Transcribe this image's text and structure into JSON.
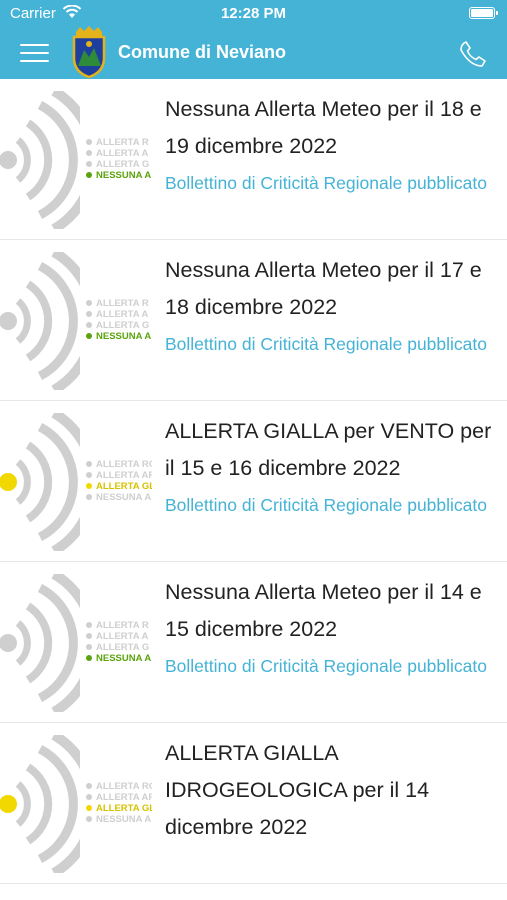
{
  "status_bar": {
    "carrier": "Carrier",
    "time": "12:28 PM"
  },
  "header": {
    "title": "Comune di Neviano"
  },
  "colors": {
    "accent": "#45b3d6",
    "link": "#45b3d6",
    "green_level": "#5aa30c",
    "yellow_level": "#f0d800"
  },
  "icons": {
    "menu": "hamburger-menu-icon",
    "phone": "phone-icon",
    "logo": "coat-of-arms-logo"
  },
  "items": [
    {
      "headline": "Nessuna Allerta Meteo per il 18 e 19 dicembre 2022",
      "subtitle": "Bollettino di Criticità Regionale pubblicato",
      "thumb": {
        "level": "green",
        "legend": [
          "ALLERTA R",
          "ALLERTA A",
          "ALLERTA G",
          "NESSUNA A"
        ]
      }
    },
    {
      "headline": "Nessuna Allerta Meteo per il 17 e 18 dicembre 2022",
      "subtitle": "Bollettino di Criticità Regionale pubblicato",
      "thumb": {
        "level": "green",
        "legend": [
          "ALLERTA R",
          "ALLERTA A",
          "ALLERTA G",
          "NESSUNA A"
        ]
      }
    },
    {
      "headline": "ALLERTA GIALLA per VENTO per il 15 e 16 dicembre 2022",
      "subtitle": "Bollettino di Criticità Regionale pubblicato",
      "thumb": {
        "level": "yellow",
        "legend": [
          "ALLERTA RO",
          "ALLERTA AF",
          "ALLERTA GL",
          "NESSUNA A"
        ]
      }
    },
    {
      "headline": "Nessuna Allerta Meteo per il 14 e 15 dicembre 2022",
      "subtitle": "Bollettino di Criticità Regionale pubblicato",
      "thumb": {
        "level": "green",
        "legend": [
          "ALLERTA R",
          "ALLERTA A",
          "ALLERTA G",
          "NESSUNA A"
        ]
      }
    },
    {
      "headline": "ALLERTA GIALLA IDROGEOLOGICA per il 14 dicembre 2022",
      "subtitle": "",
      "thumb": {
        "level": "yellow",
        "legend": [
          "ALLERTA RO",
          "ALLERTA AF",
          "ALLERTA GL",
          "NESSUNA A"
        ]
      }
    }
  ]
}
